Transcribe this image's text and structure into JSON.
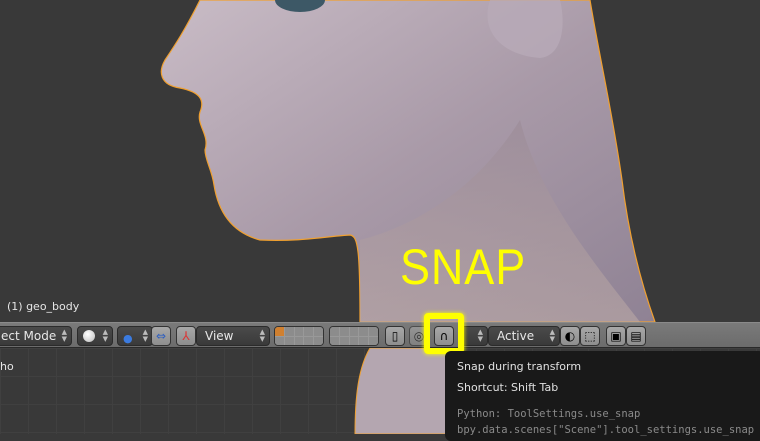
{
  "viewport": {
    "object_label": "(1) geo_body",
    "annotation": "SNAP",
    "lower_view_label": "ho"
  },
  "header": {
    "mode": "ect Mode",
    "pivot_label": "View",
    "orientation": "Active"
  },
  "tooltip": {
    "title": "Snap during transform",
    "shortcut": "Shortcut: Shift Tab",
    "python": "Python: ToolSettings.use_snap",
    "path": "bpy.data.scenes[\"Scene\"].tool_settings.use_snap"
  },
  "colors": {
    "highlight": "#ffff00",
    "selection_outline": "#f0a030",
    "background": "#393939"
  }
}
